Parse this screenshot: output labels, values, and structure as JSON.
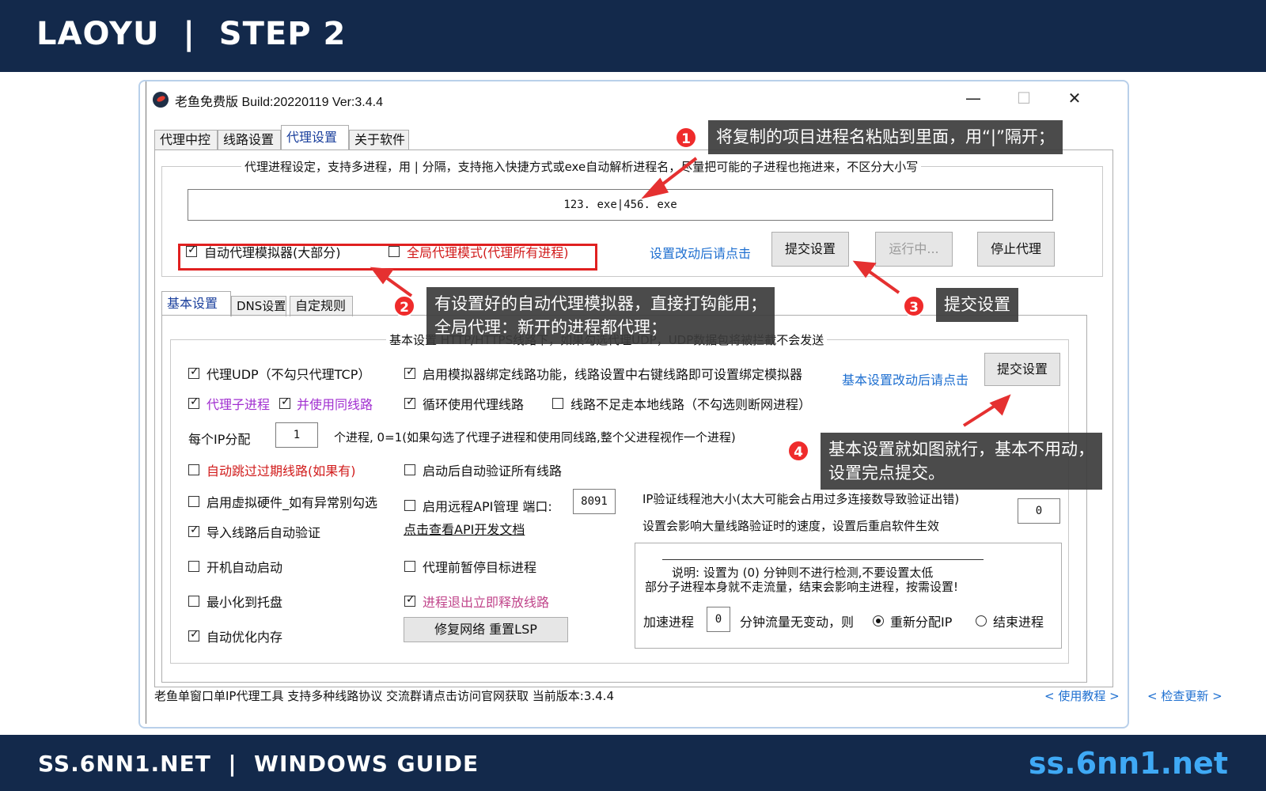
{
  "banner": {
    "title": "LAOYU  |  STEP 2",
    "footer_left": "SS.6NN1.NET  |  WINDOWS GUIDE",
    "footer_right": "ss.6nn1.net"
  },
  "window": {
    "title": "老鱼免费版 Build:20220119 Ver:3.4.4",
    "minimize": "—",
    "maximize": "☐",
    "close": "✕"
  },
  "tabs": [
    "代理中控",
    "线路设置",
    "代理设置",
    "关于软件"
  ],
  "proxy_group": {
    "title": "代理进程设定，支持多进程，用 | 分隔，支持拖入快捷方式或exe自动解析进程名，尽量把可能的子进程也拖进来，不区分大小写",
    "process_value": "123. exe|456. exe",
    "auto_emulator": "自动代理模拟器(大部分)",
    "global_mode": "全局代理模式(代理所有进程)",
    "hint_link": "设置改动后请点击",
    "submit": "提交设置",
    "running": "运行中...",
    "stop": "停止代理"
  },
  "subtabs": [
    "基本设置",
    "DNS设置",
    "自定规则"
  ],
  "basic": {
    "group_title": "基本设置  HTTP/HTTPS线路下，如果勾选代理UDP，UDP数据包将被拦截不会发送",
    "proxy_udp": "代理UDP（不勾只代理TCP）",
    "bind_emulator": "启用模拟器绑定线路功能，线路设置中右键线路即可设置绑定模拟器",
    "hint_link": "基本设置改动后请点击",
    "submit": "提交设置",
    "proxy_child": "代理子进程",
    "same_line": "并使用同线路",
    "loop_lines": "循环使用代理线路",
    "no_local": "线路不足走本地线路（不勾选则断网进程）",
    "per_ip_label": "每个IP分配",
    "per_ip_value": "1",
    "per_ip_desc": "个进程, 0=1(如果勾选了代理子进程和使用同线路,整个父进程视作一个进程)",
    "skip_expired": "自动跳过过期线路(如果有)",
    "auto_verify": "启动后自动验证所有线路",
    "virtual_hw": "启用虚拟硬件_如有异常别勾选",
    "remote_api": "启用远程API管理 端口:",
    "port_value": "8091",
    "api_doc": "点击查看API开发文档",
    "pool_label": "IP验证线程池大小(太大可能会占用过多连接数导致验证出错)",
    "pool_note": "设置会影响大量线路验证时的速度，设置后重启软件生效",
    "pool_value": "0",
    "import_verify": "导入线路后自动验证",
    "autostart": "开机自动启动",
    "pause_target": "代理前暂停目标进程",
    "tray": "最小化到托盘",
    "release_exit": "进程退出立即释放线路",
    "optimize_mem": "自动优化内存",
    "repair": "修复网络 重置LSP",
    "note_line1": "说明: 设置为 (0) 分钟则不进行检测,不要设置太低",
    "note_line2": "部分子进程本身就不走流量，结束会影响主进程，按需设置!",
    "accel_label": "加速进程",
    "accel_value": "0",
    "accel_desc": "分钟流量无变动，则",
    "realloc": "重新分配IP",
    "end_proc": "结束进程"
  },
  "status": {
    "text": "老鱼单窗口单IP代理工具 支持多种线路协议 交流群请点击访问官网获取   当前版本:3.4.4",
    "tutorial": "< 使用教程 >",
    "update": "< 检查更新 >"
  },
  "annotations": {
    "c1": "将复制的项目进程名粘贴到里面，用“|”隔开；",
    "c2a": "有设置好的自动代理模拟器，直接打钩能用；",
    "c2b": "全局代理：新开的进程都代理；",
    "c3": "提交设置",
    "c4a": "基本设置就如图就行，基本不用动，",
    "c4b": "设置完点提交。",
    "n1": "1",
    "n2": "2",
    "n3": "3",
    "n4": "4"
  },
  "colors": {
    "banner": "#13294b",
    "accent": "#3fa9f5",
    "callout": "#3c3c3c",
    "marker": "#e02020"
  }
}
